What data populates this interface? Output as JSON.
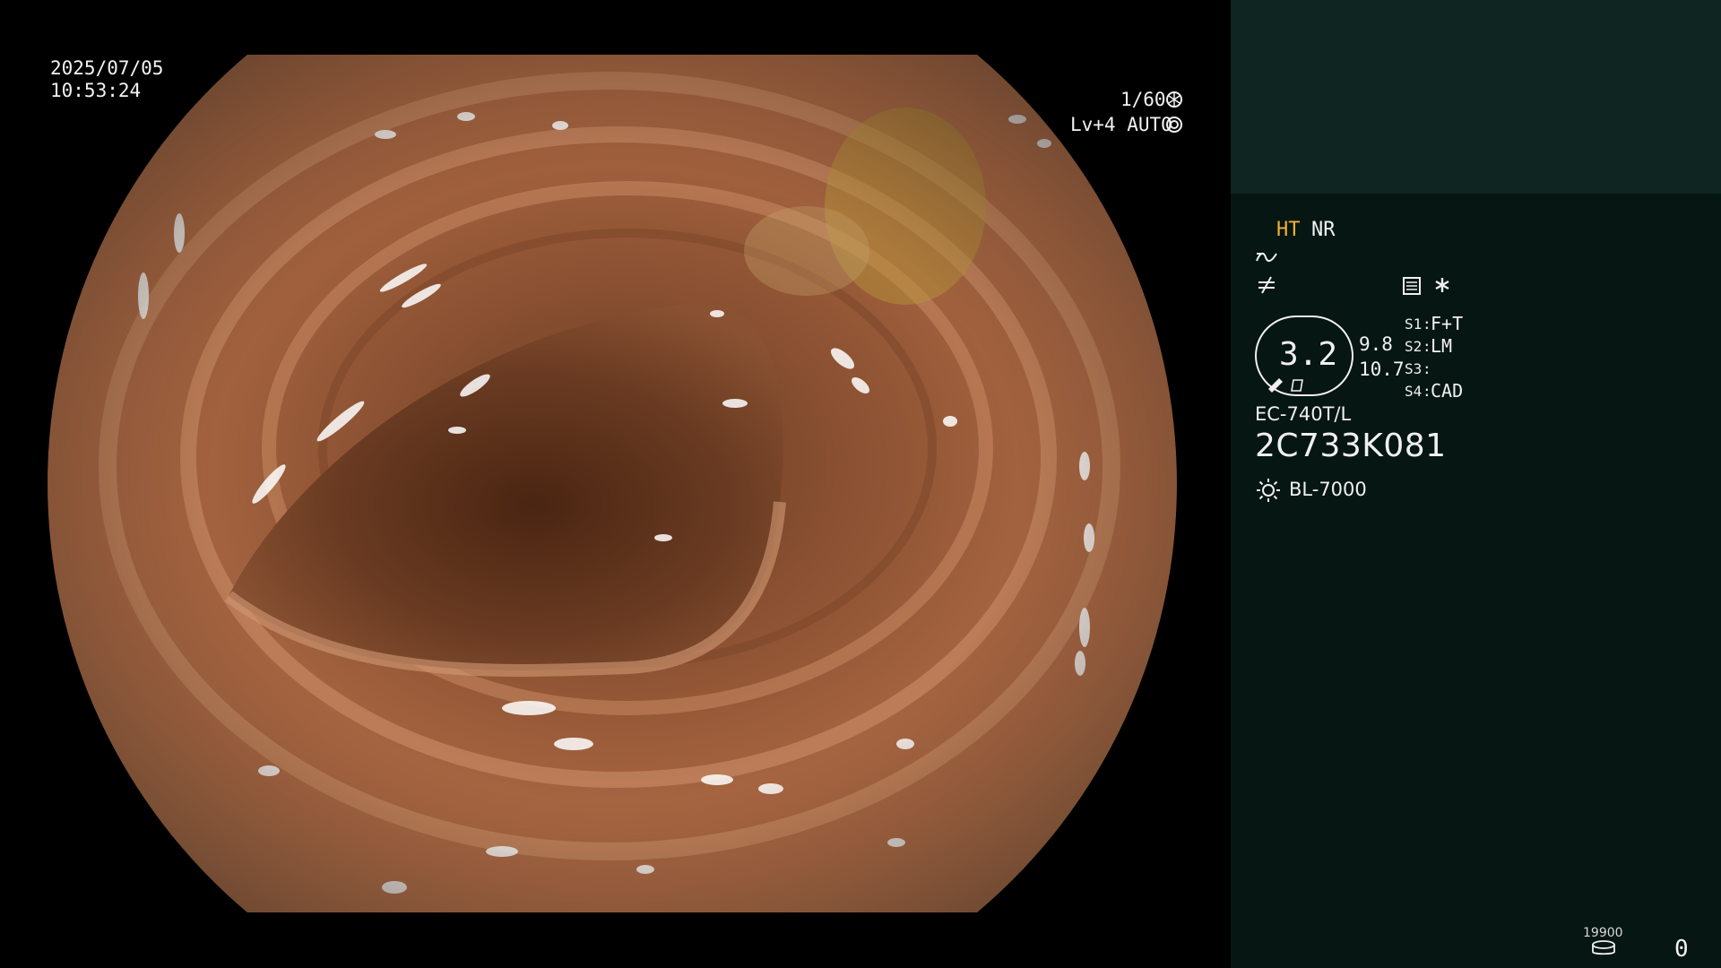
{
  "overlay": {
    "date": "2025/07/05",
    "time": "10:53:24",
    "shutter": "1/60",
    "iris_mode": "Lv+4 AUTO"
  },
  "panel": {
    "ht": "HT",
    "nr": "NR",
    "zoom_value": "3.2",
    "stat_a": "9.8",
    "stat_b": "10.7",
    "switches": [
      {
        "key": "S1",
        "value": "F+T"
      },
      {
        "key": "S2",
        "value": "LM"
      },
      {
        "key": "S3",
        "value": ""
      },
      {
        "key": "S4",
        "value": "CAD"
      }
    ],
    "scope_model": "EC-740T/L",
    "scope_serial": "2C733K081",
    "light_source": "BL-7000",
    "storage_count": "19900",
    "counter": "0"
  },
  "icons": {
    "shutter": "aperture-icon",
    "iris": "iris-icon",
    "wave": "wave-icon",
    "notequal": "structure-enhancement-icon",
    "menu": "document-icon",
    "asterisk": "asterisk-icon",
    "pen": "pen-icon",
    "bracket": "bracket-icon",
    "light": "light-bulb-icon",
    "storage": "storage-icon"
  },
  "colors": {
    "panel_top": "#0e2522",
    "panel_bottom": "#061613",
    "ht_accent": "#f2b033",
    "tissue": "#b06a45"
  }
}
